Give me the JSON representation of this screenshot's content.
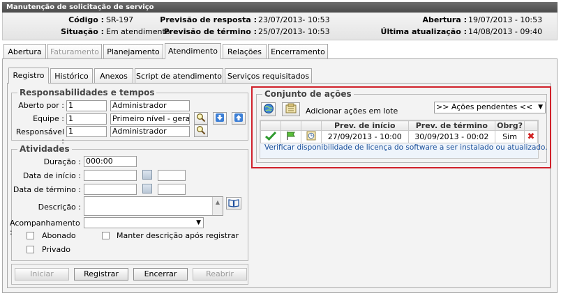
{
  "window": {
    "title": "Manutenção de solicitação de serviço"
  },
  "info": {
    "codigo_label": "Código :",
    "codigo_value": "SR-197",
    "situacao_label": "Situação :",
    "situacao_value": "Em atendimento",
    "prev_resposta_label": "Previsão de resposta :",
    "prev_resposta_value": "23/07/2013- 10:53",
    "prev_termino_label": "Previsão de término :",
    "prev_termino_value": "25/07/2013- 10:53",
    "abertura_label": "Abertura :",
    "abertura_value": "19/07/2013 - 10:53",
    "ultima_label": "Última atualização :",
    "ultima_value": "14/08/2013 - 09:40"
  },
  "main_tabs": [
    "Abertura",
    "Faturamento",
    "Planejamento",
    "Atendimento",
    "Relações",
    "Encerramento"
  ],
  "sub_tabs": [
    "Registro",
    "Histórico",
    "Anexos",
    "Script de atendimento",
    "Serviços requisitados"
  ],
  "resp": {
    "legend": "Responsabilidades e tempos",
    "aberto_label": "Aberto por :",
    "aberto_id": "1",
    "aberto_name": "Administrador",
    "equipe_label": "Equipe :",
    "equipe_id": "1",
    "equipe_name": "Primeiro nível - geral",
    "responsavel_label": "Responsável :",
    "responsavel_id": "1",
    "responsavel_name": "Administrador"
  },
  "atividades": {
    "legend": "Atividades",
    "duracao_label": "Duração :",
    "duracao_value": "000:00",
    "inicio_label": "Data de início :",
    "termino_label": "Data de término :",
    "descricao_label": "Descrição :",
    "acompanhamento_label": "Acompanhamento :",
    "abonado_label": "Abonado",
    "manter_label": "Manter descrição após registrar",
    "privado_label": "Privado"
  },
  "footer_buttons": {
    "iniciar": "Iniciar",
    "registrar": "Registrar",
    "encerrar": "Encerrar",
    "reabrir": "Reabrir"
  },
  "acoes": {
    "legend": "Conjunto de ações",
    "lote_label": "Adicionar ações em lote",
    "filter_value": ">> Ações pendentes <<",
    "col_inicio": "Prev. de início",
    "col_termino": "Prev. de término",
    "col_obrg": "Obrg?",
    "row_inicio": "27/09/2013 - 10:00",
    "row_termino": "30/09/2013 - 00:02",
    "row_obrg": "Sim",
    "row_desc": "Verificar disponibilidade de licença do software a ser instalado ou atualizado."
  },
  "colors": {
    "highlight": "#d0202a",
    "link": "#1a4f9a"
  }
}
